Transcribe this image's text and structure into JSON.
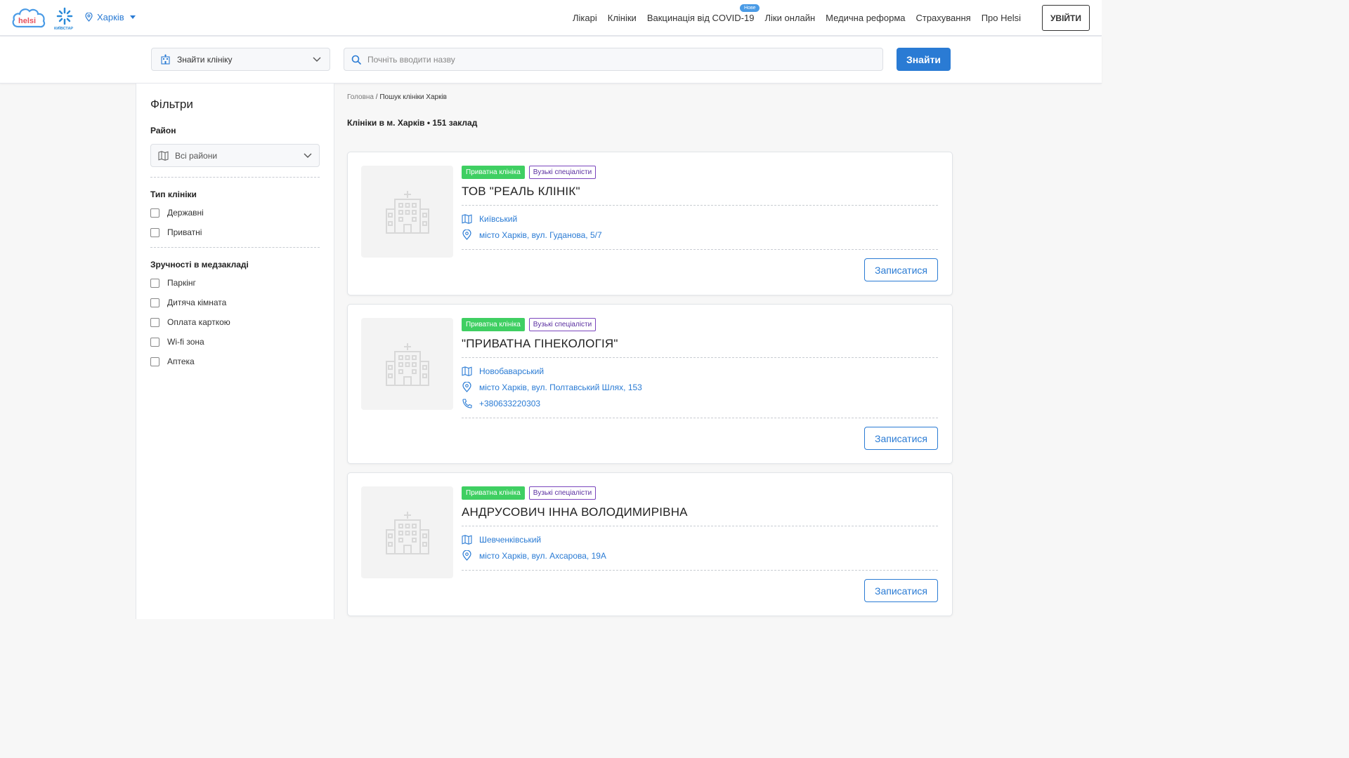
{
  "header": {
    "city": "Харків",
    "nav": [
      {
        "label": "Лікарі"
      },
      {
        "label": "Клініки"
      },
      {
        "label": "Вакцинація від COVID-19",
        "badge": "Нове"
      },
      {
        "label": "Ліки онлайн"
      },
      {
        "label": "Медична реформа"
      },
      {
        "label": "Страхування"
      },
      {
        "label": "Про Helsi"
      }
    ],
    "login_label": "УВІЙТИ"
  },
  "logos": {
    "helsi": "helsi",
    "kyivstar": "КИЇВСТАР"
  },
  "search": {
    "clinic_select_label": "Знайти клініку",
    "placeholder": "Почніть вводити назву",
    "find_label": "Знайти"
  },
  "filters": {
    "title": "Фільтри",
    "district_title": "Район",
    "district_value": "Всі райони",
    "type_title": "Тип клініки",
    "types": [
      "Державні",
      "Приватні"
    ],
    "amenities_title": "Зручності в медзакладі",
    "amenities": [
      "Паркінг",
      "Дитяча кімната",
      "Оплата карткою",
      "Wi-fi зона",
      "Аптека"
    ]
  },
  "breadcrumb": {
    "home": "Головна",
    "separator": " / ",
    "current": "Пошук клініки Харків"
  },
  "results_title": "Клініки в м. Харків • 151 заклад",
  "clinics": [
    {
      "tag_type": "Приватна клініка",
      "tag_spec": "Вузькі спеціалісти",
      "name": "ТОВ \"РЕАЛЬ КЛІНІК\"",
      "district": "Київський",
      "address": "місто Харків, вул. Гуданова, 5/7",
      "phone": "",
      "book_label": "Записатися"
    },
    {
      "tag_type": "Приватна клініка",
      "tag_spec": "Вузькі спеціалісти",
      "name": "\"ПРИВАТНА ГІНЕКОЛОГІЯ\"",
      "district": "Новобаварський",
      "address": "місто Харків, вул. Полтавський Шлях, 153",
      "phone": "+380633220303",
      "book_label": "Записатися"
    },
    {
      "tag_type": "Приватна клініка",
      "tag_spec": "Вузькі спеціалісти",
      "name": "АНДРУСОВИЧ ІННА ВОЛОДИМИРІВНА",
      "district": "Шевченківський",
      "address": "місто Харків, вул. Ахсарова, 19А",
      "phone": "",
      "book_label": "Записатися"
    }
  ],
  "colors": {
    "accent": "#2a7bd4",
    "private_tag": "#3fcf62",
    "spec_tag": "#7a45bd"
  }
}
